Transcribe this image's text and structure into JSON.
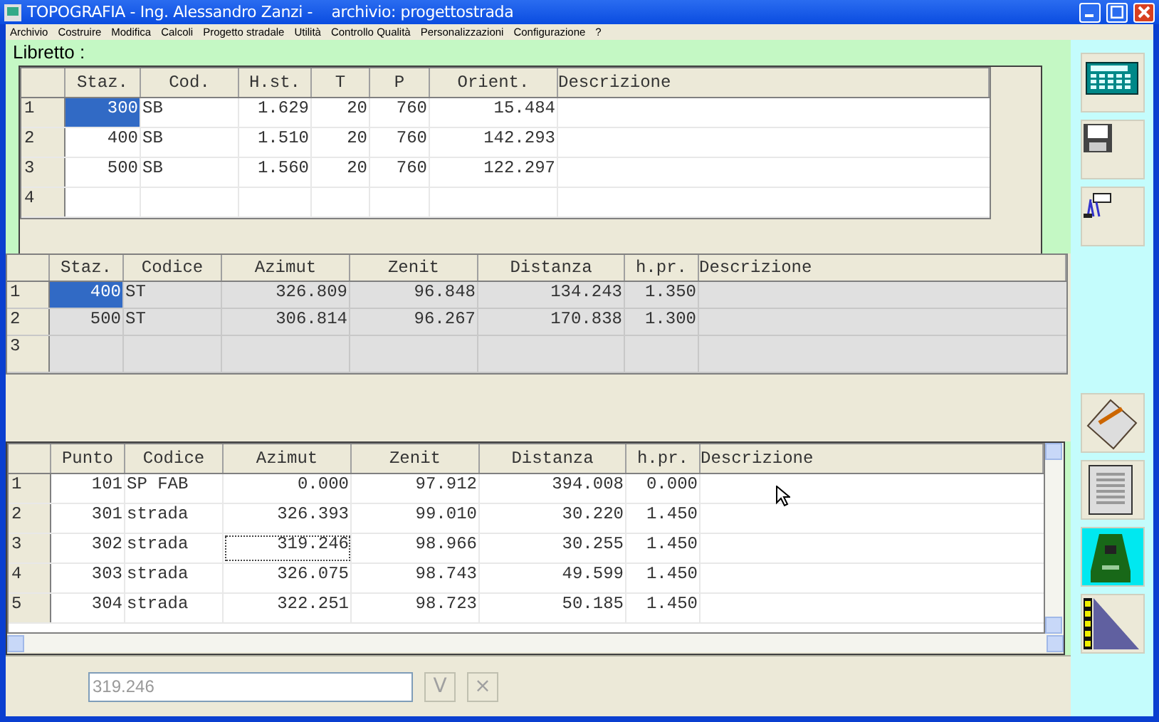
{
  "window": {
    "title": "TOPOGRAFIA - Ing. Alessandro Zanzi -    archivio: progettostrada"
  },
  "menu": [
    "Archivio",
    "Costruire",
    "Modifica",
    "Calcoli",
    "Progetto stradale",
    "Utilità",
    "Controllo Qualità",
    "Personalizzazioni",
    "Configurazione",
    "?"
  ],
  "libretto": {
    "title": "Libretto :",
    "readonly": false,
    "columns": [
      "Staz.",
      "Cod.",
      "H.st.",
      "T",
      "P",
      "Orient.",
      "Descrizione"
    ],
    "rows": [
      {
        "num": "1",
        "selected": true,
        "cells": [
          "300",
          "SB",
          "1.629",
          "20",
          "760",
          "15.484"
        ]
      },
      {
        "num": "2",
        "selected": false,
        "cells": [
          "400",
          "SB",
          "1.510",
          "20",
          "760",
          "142.293"
        ]
      },
      {
        "num": "3",
        "selected": false,
        "cells": [
          "500",
          "SB",
          "1.560",
          "20",
          "760",
          "122.297"
        ]
      },
      {
        "num": "4",
        "selected": false,
        "cells": []
      }
    ]
  },
  "stations": {
    "readonly": true,
    "columns": [
      "Staz.",
      "Codice",
      "Azimut",
      "Zenit",
      "Distanza",
      "h.pr.",
      "Descrizione"
    ],
    "rows": [
      {
        "num": "1",
        "selected": true,
        "cells": [
          "400",
          "ST",
          "326.809",
          "96.848",
          "134.243",
          "1.350"
        ]
      },
      {
        "num": "2",
        "selected": false,
        "cells": [
          "500",
          "ST",
          "306.814",
          "96.267",
          "170.838",
          "1.300"
        ]
      },
      {
        "num": "3",
        "selected": false,
        "cells": []
      }
    ]
  },
  "points": {
    "readonly": false,
    "columns": [
      "Punto",
      "Codice",
      "Azimut",
      "Zenit",
      "Distanza",
      "h.pr.",
      "Descrizione"
    ],
    "rows": [
      {
        "num": "1",
        "focused": false,
        "cells": [
          "101",
          "SP FAB",
          "0.000",
          "97.912",
          "394.008",
          "0.000"
        ]
      },
      {
        "num": "2",
        "focused": false,
        "cells": [
          "301",
          "strada",
          "326.393",
          "99.010",
          "30.220",
          "1.450"
        ]
      },
      {
        "num": "3",
        "focused": true,
        "cells": [
          "302",
          "strada",
          "319.246",
          "98.966",
          "30.255",
          "1.450"
        ]
      },
      {
        "num": "4",
        "focused": false,
        "cells": [
          "303",
          "strada",
          "326.075",
          "98.743",
          "49.599",
          "1.450"
        ]
      },
      {
        "num": "5",
        "focused": false,
        "cells": [
          "304",
          "strada",
          "322.251",
          "98.723",
          "50.185",
          "1.450"
        ]
      }
    ]
  },
  "editor": {
    "value": "319.246",
    "disabled": true,
    "buttons": [
      {
        "label": "V",
        "disabled": true
      },
      {
        "label": "×",
        "disabled": true
      }
    ]
  }
}
